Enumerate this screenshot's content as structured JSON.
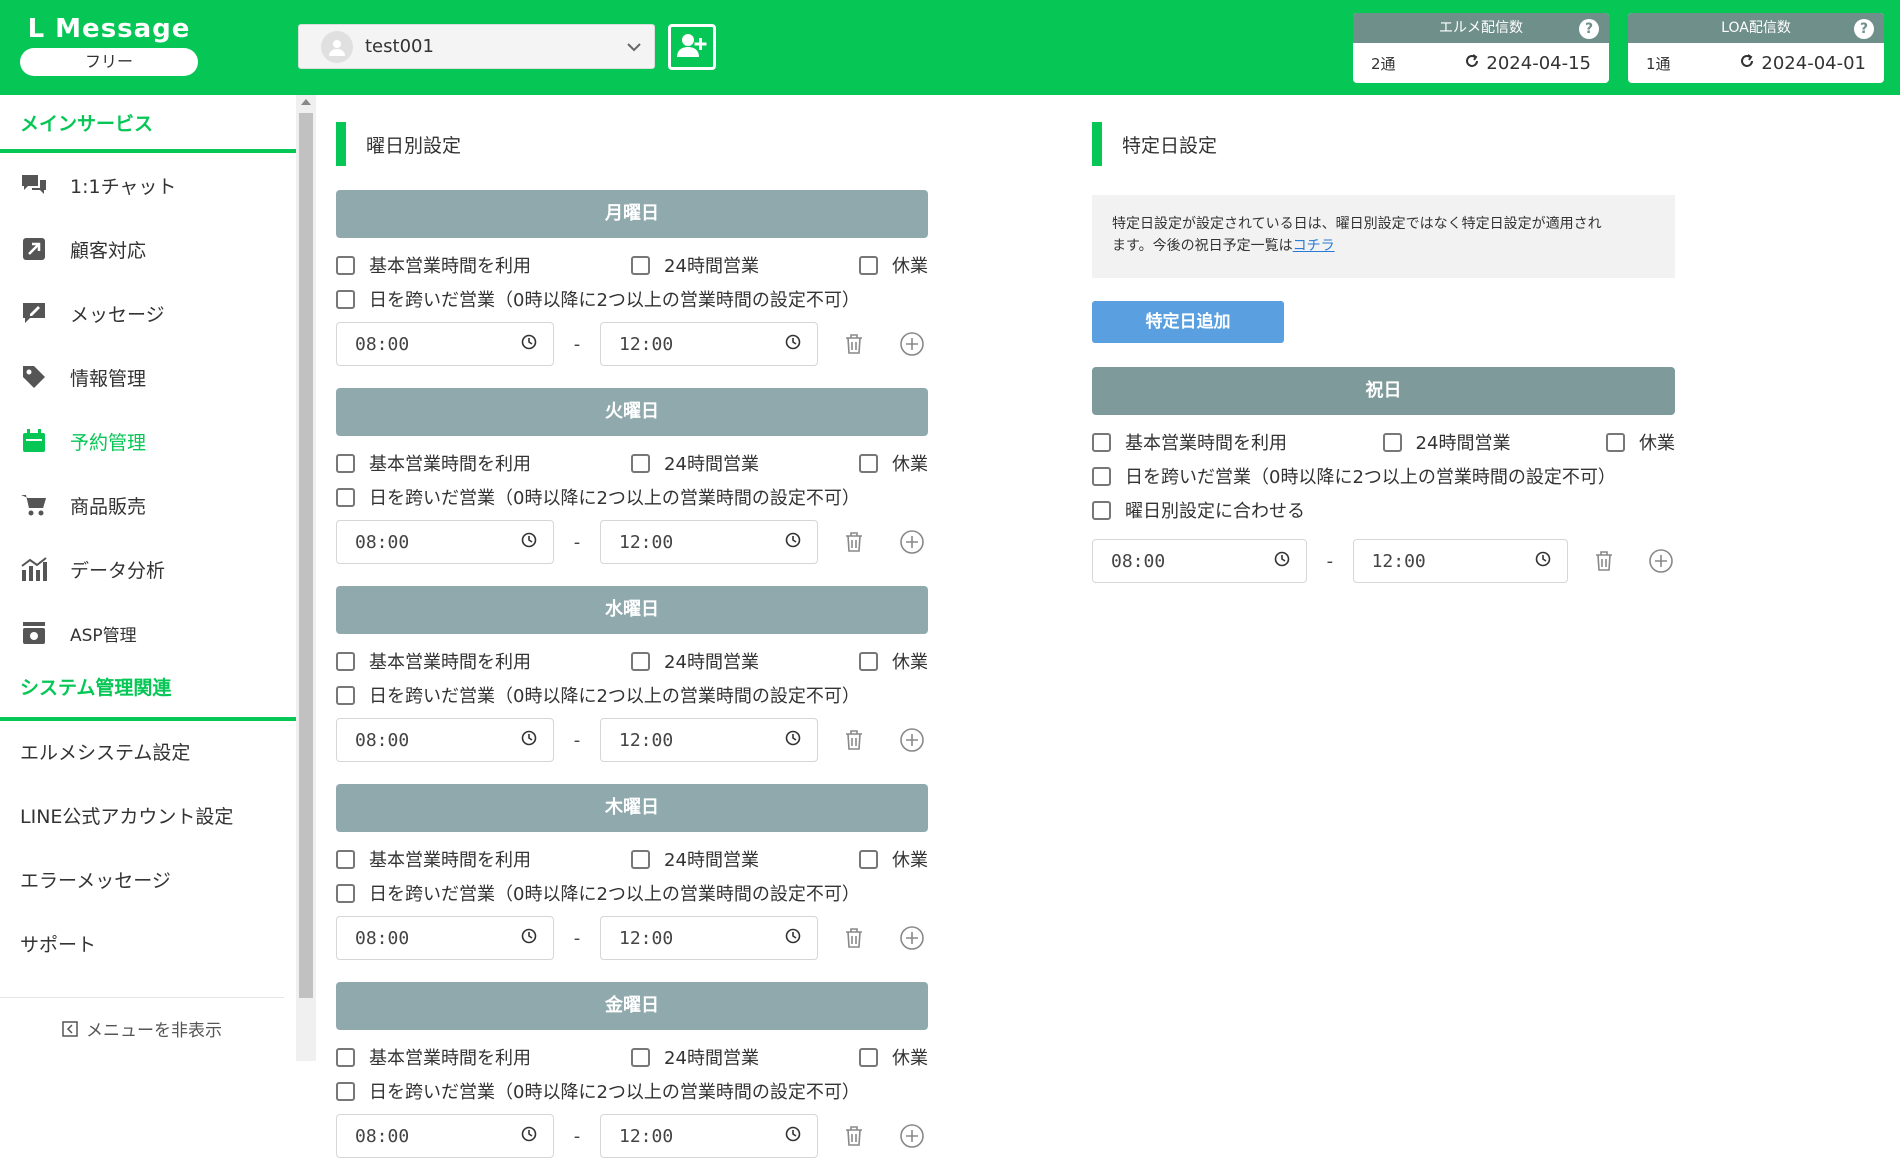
{
  "header": {
    "logo_title": "L Message",
    "logo_plan": "フリー",
    "account_name": "test001",
    "stats": [
      {
        "title": "エルメ配信数",
        "count": "2通",
        "date": "2024-04-15"
      },
      {
        "title": "LOA配信数",
        "count": "1通",
        "date": "2024-04-01"
      }
    ]
  },
  "sidebar": {
    "section_main": "メインサービス",
    "items": [
      {
        "label": "1:1チャット",
        "icon": "chat-icon"
      },
      {
        "label": "顧客対応",
        "icon": "arrow-up-right-icon"
      },
      {
        "label": "メッセージ",
        "icon": "pen-message-icon"
      },
      {
        "label": "情報管理",
        "icon": "tag-icon"
      },
      {
        "label": "予約管理",
        "icon": "calendar-icon"
      },
      {
        "label": "商品販売",
        "icon": "cart-icon"
      },
      {
        "label": "データ分析",
        "icon": "chart-icon"
      },
      {
        "label": "ASP管理",
        "icon": "asp-icon"
      }
    ],
    "section_system": "システム管理関連",
    "system_items": [
      "エルメシステム設定",
      "LINE公式アカウント設定",
      "エラーメッセージ",
      "サポート"
    ],
    "hide_menu": "メニューを非表示"
  },
  "weekday": {
    "title": "曜日別設定",
    "opt_basic": "基本営業時間を利用",
    "opt_24h": "24時間営業",
    "opt_closed": "休業",
    "opt_overnight": "日を跨いだ営業（0時以降に2つ以上の営業時間の設定不可）",
    "time_start": "08:00",
    "time_end": "12:00",
    "dash": "-",
    "days": [
      "月曜日",
      "火曜日",
      "水曜日",
      "木曜日",
      "金曜日"
    ]
  },
  "special": {
    "title": "特定日設定",
    "notice_line1": "特定日設定が設定されている日は、曜日別設定ではなく特定日設定が適用され",
    "notice_line2": "ます。今後の祝日予定一覧は",
    "notice_link": "コチラ",
    "add_button": "特定日追加",
    "holiday_label": "祝日",
    "opt_basic": "基本営業時間を利用",
    "opt_24h": "24時間営業",
    "opt_closed": "休業",
    "opt_overnight": "日を跨いだ営業（0時以降に2つ以上の営業時間の設定不可）",
    "opt_match": "曜日別設定に合わせる",
    "time_start": "08:00",
    "time_end": "12:00",
    "dash": "-"
  },
  "colors": {
    "brand": "#06c755",
    "day_header": "#8fa9ac",
    "button_blue": "#5aa0e0"
  }
}
